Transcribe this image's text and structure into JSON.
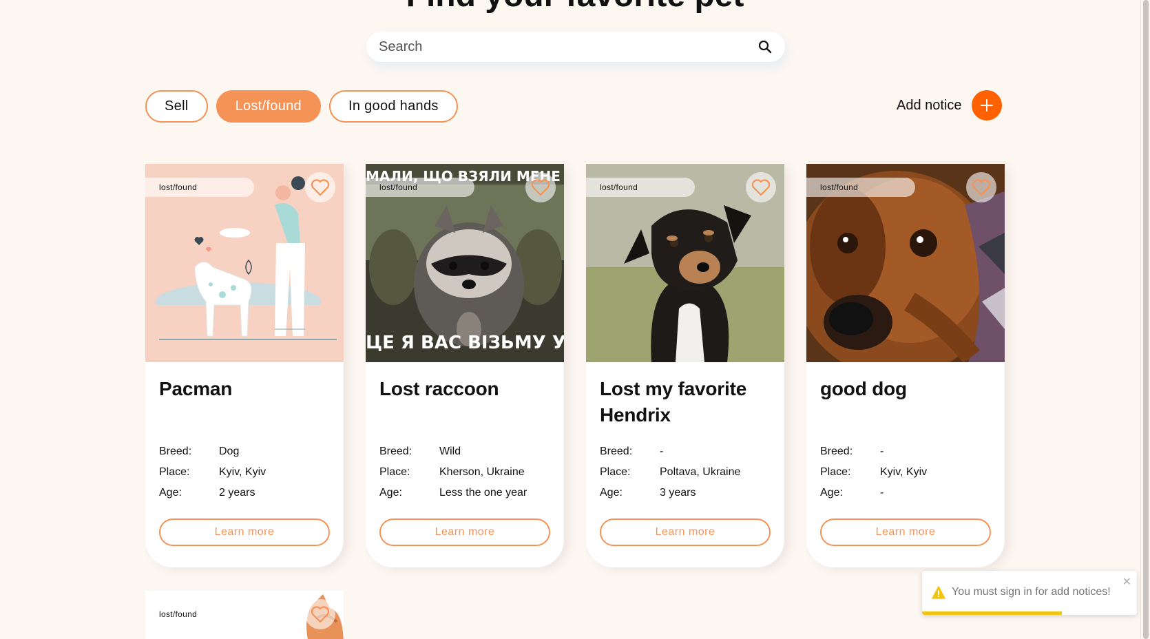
{
  "page": {
    "title": "Find your favorite pet"
  },
  "search": {
    "placeholder": "Search"
  },
  "filters": [
    {
      "label": "Sell",
      "active": false
    },
    {
      "label": "Lost/found",
      "active": true
    },
    {
      "label": "In good hands",
      "active": false
    }
  ],
  "add_notice": {
    "label": "Add notice"
  },
  "labels": {
    "breed": "Breed:",
    "place": "Place:",
    "age": "Age:"
  },
  "cards": [
    {
      "category": "lost/found",
      "title": "Pacman",
      "breed": "Dog",
      "place": "Kyiv, Kyiv",
      "age": "2 years",
      "button": "Learn more"
    },
    {
      "category": "lost/found",
      "title": "Lost raccoon",
      "breed": "Wild",
      "place": "Kherson, Ukraine",
      "age": "Less the one year",
      "button": "Learn more",
      "image_text_top": "МАЛИ, ЩО ВЗЯЛИ МЕНЕ В ПО",
      "image_text_bottom": "ЦЕ Я ВАС ВІЗЬМУ У ПО"
    },
    {
      "category": "lost/found",
      "title": "Lost my favorite Hendrix",
      "breed": "-",
      "place": "Poltava, Ukraine",
      "age": "3 years",
      "button": "Learn more"
    },
    {
      "category": "lost/found",
      "title": "good dog",
      "breed": "-",
      "place": "Kyiv, Kyiv",
      "age": "-",
      "button": "Learn more"
    },
    {
      "category": "lost/found"
    }
  ],
  "toast": {
    "message": "You must sign in for add notices!",
    "icon": "warning-icon",
    "progress": 0.65
  },
  "colors": {
    "accent": "#F59256",
    "add_button": "#FF6101",
    "background": "#FDF7F2",
    "toast_progress": "#F1C40F"
  }
}
